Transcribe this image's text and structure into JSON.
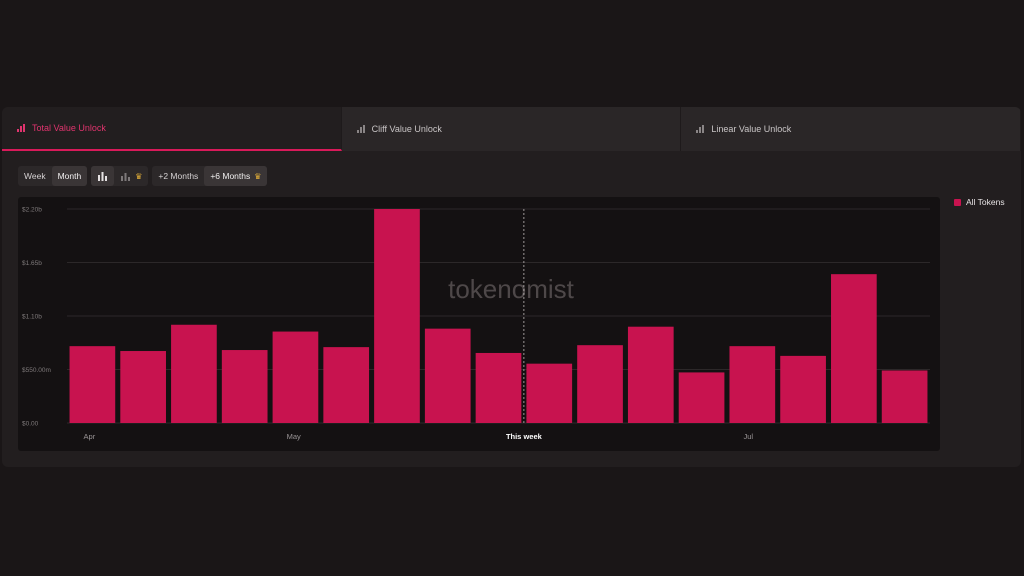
{
  "tabs": [
    {
      "label": "Total Value Unlock",
      "icon": "bar-chart-icon",
      "active": true
    },
    {
      "label": "Cliff Value Unlock",
      "icon": "bar-chart-icon",
      "active": false
    },
    {
      "label": "Linear Value Unlock",
      "icon": "bar-chart-icon",
      "active": false
    }
  ],
  "toolbar": {
    "week_label": "Week",
    "month_label": "Month",
    "plus2_label": "+2 Months",
    "plus6_label": "+6 Months",
    "premium_icon": "crown-icon"
  },
  "legend": {
    "label": "All Tokens",
    "color": "#c8134f"
  },
  "watermark": "tokenomist",
  "colors": {
    "accent": "#d91a5a",
    "bar": "#c8134f"
  },
  "chart_data": {
    "type": "bar",
    "series": [
      {
        "name": "All Tokens",
        "values": [
          0.79,
          0.74,
          1.01,
          0.75,
          0.94,
          0.78,
          2.2,
          0.97,
          0.72,
          0.61,
          0.8,
          0.99,
          0.52,
          0.79,
          0.69,
          1.53,
          0.54
        ]
      }
    ],
    "unit": "billions USD",
    "y_ticks": [
      "$0.00",
      "$550.00m",
      "$1.10b",
      "$1.65b",
      "$2.20b"
    ],
    "ylim": [
      0,
      2.2
    ],
    "x_labels": [
      "Apr",
      "May",
      "This week",
      "Jul"
    ],
    "x_label_positions": [
      0,
      4,
      8.5,
      13
    ],
    "current_marker_index": 8.5,
    "grid": true
  }
}
